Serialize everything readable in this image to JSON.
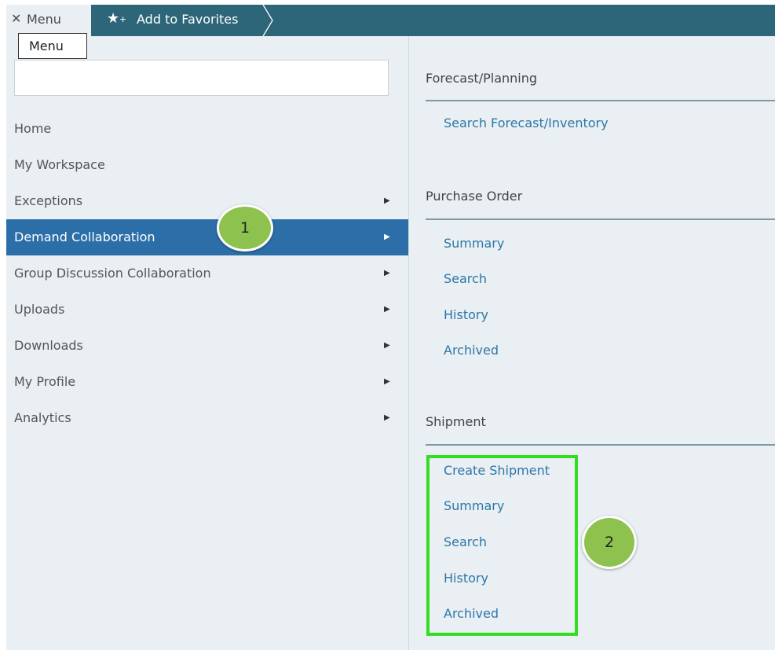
{
  "topbar": {
    "close_icon": "close-icon",
    "menu_label": "Menu",
    "menu_tooltip": "Menu",
    "favorites_icon": "star-plus-icon",
    "favorites_label": "Add to Favorites"
  },
  "sidebar": {
    "search": {
      "value": "",
      "placeholder": ""
    },
    "items": [
      {
        "label": "Home",
        "has_submenu": false
      },
      {
        "label": "My Workspace",
        "has_submenu": false
      },
      {
        "label": "Exceptions",
        "has_submenu": true
      },
      {
        "label": "Demand Collaboration",
        "has_submenu": true,
        "active": true
      },
      {
        "label": "Group Discussion Collaboration",
        "has_submenu": true
      },
      {
        "label": "Uploads",
        "has_submenu": true
      },
      {
        "label": "Downloads",
        "has_submenu": true
      },
      {
        "label": "My Profile",
        "has_submenu": true
      },
      {
        "label": "Analytics",
        "has_submenu": true
      }
    ]
  },
  "submenu": {
    "sections": [
      {
        "title": "Forecast/Planning",
        "links": [
          "Search Forecast/Inventory"
        ]
      },
      {
        "title": "Purchase Order",
        "links": [
          "Summary",
          "Search",
          "History",
          "Archived"
        ]
      },
      {
        "title": "Shipment",
        "links": [
          "Create Shipment",
          "Summary",
          "Search",
          "History",
          "Archived"
        ]
      }
    ]
  },
  "annotations": {
    "step1": "1",
    "step2": "2"
  },
  "colors": {
    "topbar": "#2c6678",
    "active_item": "#2c6fa8",
    "link": "#2d76a8",
    "badge": "#8dc24f",
    "highlight": "#33dd22",
    "panel_bg": "#e9eff2"
  }
}
